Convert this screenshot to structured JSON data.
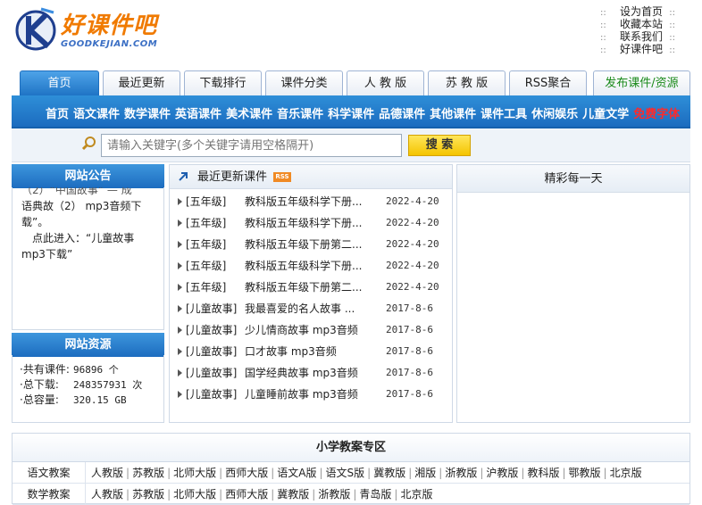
{
  "header": {
    "logo_title": "好课件吧",
    "logo_url": "GOODKEJIAN.COM",
    "top_links": [
      "设为首页",
      "收藏本站",
      "联系我们",
      "好课件吧"
    ],
    "sep": "::"
  },
  "tabs": [
    {
      "label": "首页",
      "active": true
    },
    {
      "label": "最近更新"
    },
    {
      "label": "下载排行"
    },
    {
      "label": "课件分类"
    },
    {
      "label": "人 教 版"
    },
    {
      "label": "苏 教 版"
    },
    {
      "label": "RSS聚合"
    },
    {
      "label": "发布课件/资源"
    }
  ],
  "nav": {
    "items": [
      "首页",
      "语文课件",
      "数学课件",
      "英语课件",
      "美术课件",
      "音乐课件",
      "科学课件",
      "品德课件",
      "其他课件",
      "课件工具",
      "休闲娱乐",
      "儿童文学"
    ],
    "highlight": "免费字体"
  },
  "search": {
    "placeholder": "请输入关键字(多个关键字请用空格隔开)",
    "button": "搜 索"
  },
  "notice": {
    "title": "网站公告",
    "text_partial": "（2）“中国故事” — 成",
    "line1": "语典故（2） mp3音频下",
    "line2": "载”。",
    "line3": "　点此进入：“儿童故事",
    "line4": "mp3下载”"
  },
  "stats": {
    "title": "网站资源",
    "rows": [
      {
        "label": "·共有课件:",
        "value": "96896 个"
      },
      {
        "label": "·总下载:",
        "value": "248357931 次"
      },
      {
        "label": "·总容量:",
        "value": "320.15 GB"
      }
    ]
  },
  "recent": {
    "title": "最近更新课件",
    "rss": "RSS",
    "items": [
      {
        "cat": "[五年级]",
        "name": "教科版五年级科学下册...",
        "date": "2022-4-20"
      },
      {
        "cat": "[五年级]",
        "name": "教科版五年级科学下册...",
        "date": "2022-4-20"
      },
      {
        "cat": "[五年级]",
        "name": "教科版五年级下册第二...",
        "date": "2022-4-20"
      },
      {
        "cat": "[五年级]",
        "name": "教科版五年级科学下册...",
        "date": "2022-4-20"
      },
      {
        "cat": "[五年级]",
        "name": "教科版五年级下册第二...",
        "date": "2022-4-20"
      },
      {
        "cat": "[儿童故事]",
        "name": "我最喜爱的名人故事 ...",
        "date": "2017-8-6"
      },
      {
        "cat": "[儿童故事]",
        "name": "少儿情商故事 mp3音频",
        "date": "2017-8-6"
      },
      {
        "cat": "[儿童故事]",
        "name": "口才故事 mp3音频",
        "date": "2017-8-6"
      },
      {
        "cat": "[儿童故事]",
        "name": "国学经典故事 mp3音频",
        "date": "2017-8-6"
      },
      {
        "cat": "[儿童故事]",
        "name": "儿童睡前故事 mp3音频",
        "date": "2017-8-6"
      }
    ]
  },
  "daily": {
    "title": "精彩每一天"
  },
  "lesson_zone": {
    "title": "小学教案专区",
    "rows": [
      {
        "label": "语文教案",
        "links": [
          "人教版",
          "苏教版",
          "北师大版",
          "西师大版",
          "语文A版",
          "语文S版",
          "冀教版",
          "湘版",
          "浙教版",
          "沪教版",
          "教科版",
          "鄂教版",
          "北京版"
        ]
      },
      {
        "label": "数学教案",
        "links": [
          "人教版",
          "苏教版",
          "北师大版",
          "西师大版",
          "冀教版",
          "浙教版",
          "青岛版",
          "北京版"
        ]
      }
    ]
  }
}
